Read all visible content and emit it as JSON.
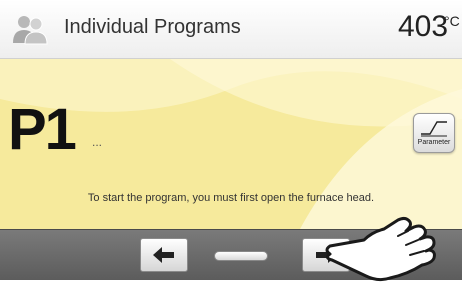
{
  "header": {
    "title": "Individual Programs",
    "temperature": "403",
    "unit": "°C",
    "icon": "users-icon"
  },
  "program": {
    "code": "P1",
    "name": "..."
  },
  "parameter_button": {
    "label": "Parameter",
    "icon": "firing-curve-icon"
  },
  "message": "To start the program, you must first open the furnace head.",
  "navigation": {
    "back_icon": "arrow-left-icon",
    "forward_icon": "arrow-right-icon",
    "page_indicator_icon": "page-indicator"
  },
  "colors": {
    "panel_background": "#f6ea9c",
    "bottom_bar": "#6a6a6a",
    "header_background": "#f4f4f4"
  }
}
